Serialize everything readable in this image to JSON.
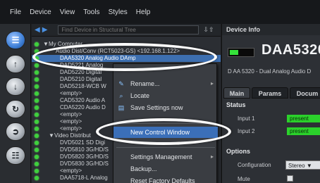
{
  "menubar": {
    "items": [
      "File",
      "Device",
      "View",
      "Tools",
      "Styles",
      "Help"
    ]
  },
  "lefttoolbar": {
    "buttons": [
      {
        "icon": "sliders-icon",
        "glyph": "☰"
      },
      {
        "icon": "up-arrow-icon",
        "glyph": "↑"
      },
      {
        "icon": "down-arrow-icon",
        "glyph": "↓"
      },
      {
        "icon": "refresh-icon",
        "glyph": "↻"
      },
      {
        "icon": "import-icon",
        "glyph": "➲"
      },
      {
        "icon": "network-icon",
        "glyph": "☷"
      }
    ]
  },
  "tree": {
    "search_placeholder": "Find Device in Structural Tree",
    "rows": [
      {
        "text": "My Computer",
        "expander": "▼"
      },
      {
        "text": "Audio Dist/Conv (RCT5023-GS) <192.168.1.122>"
      },
      {
        "text": "DAA5320 Analog Audio DAmp"
      },
      {
        "text": "DAD5221 Analog"
      },
      {
        "text": "DAD5220 Digital"
      },
      {
        "text": "DAD5210 Digital"
      },
      {
        "text": "DAD5218-WCB W"
      },
      {
        "text": "<empty>"
      },
      {
        "text": "CAD5320 Audio A"
      },
      {
        "text": "CDA5220 Audio D"
      },
      {
        "text": "<empty>"
      },
      {
        "text": "<empty>"
      },
      {
        "text": "<empty>"
      },
      {
        "text": "Video Distribut",
        "expander": "▼"
      },
      {
        "text": "DVD5021 SD Digi"
      },
      {
        "text": "DVD5810 3G/HD/S"
      },
      {
        "text": "DVD5820 3G/HD/S"
      },
      {
        "text": "DVD5830 3G/HD/S"
      },
      {
        "text": "<empty>"
      },
      {
        "text": "DAA5718-L Analog"
      }
    ]
  },
  "context_menu": {
    "items": [
      {
        "label": "Rename...",
        "icon": "pencil-icon",
        "glyph": "✎"
      },
      {
        "label": "Locate",
        "icon": "search-icon",
        "glyph": "⌕"
      },
      {
        "label": "Save Settings now",
        "icon": "save-icon",
        "glyph": "▤"
      },
      {
        "label": "New Control Window",
        "icon": "",
        "glyph": ""
      },
      {
        "label": "Settings Management",
        "icon": "",
        "glyph": ""
      },
      {
        "label": "Backup...",
        "icon": "",
        "glyph": ""
      },
      {
        "label": "Reset Factory Defaults",
        "icon": "",
        "glyph": ""
      }
    ]
  },
  "device_info": {
    "title": "Device Info",
    "name": "DAA5320",
    "description": "D AA 5320 - Dual Analog Audio D",
    "tabs": [
      "Main",
      "Params",
      "Docum"
    ],
    "status": {
      "heading": "Status",
      "rows": [
        {
          "label": "Input 1",
          "value": "present"
        },
        {
          "label": "Input 2",
          "value": "present"
        }
      ]
    },
    "options": {
      "heading": "Options",
      "configuration_label": "Configuration",
      "configuration_value": "Stereo",
      "mute_label": "Mute"
    }
  },
  "colors": {
    "accent": "#3b6fb8",
    "status_ok": "#2bd12b",
    "annotation": "#fafafa"
  }
}
